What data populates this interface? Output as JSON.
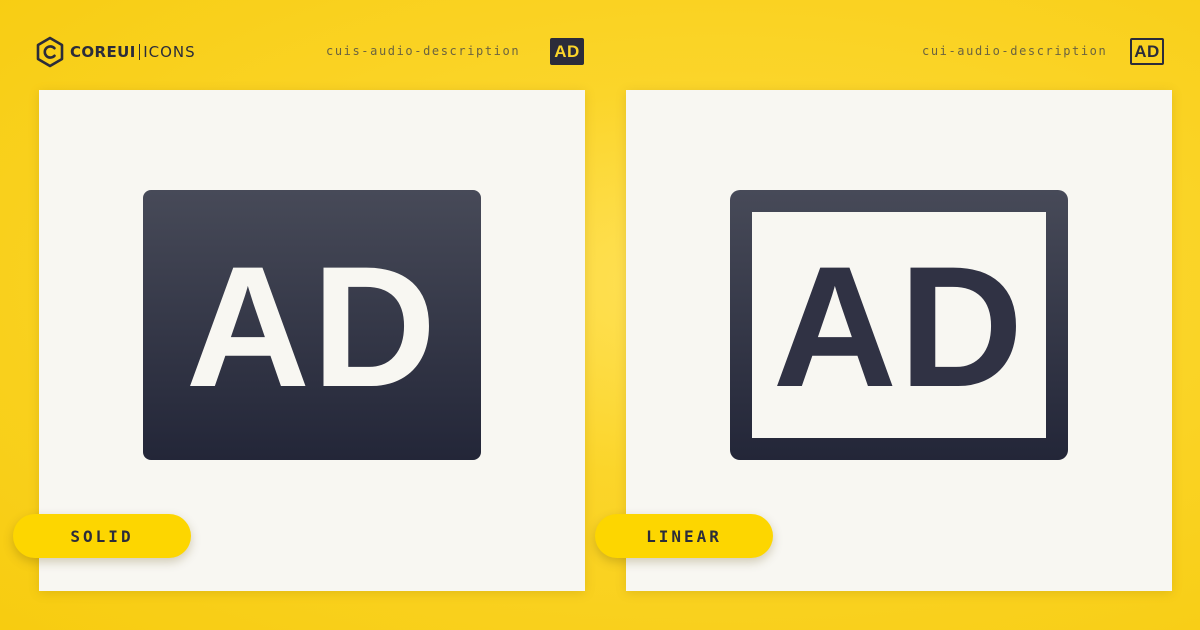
{
  "brand": {
    "logo_core": "COREUI",
    "logo_icons": "ICONS",
    "logo_icon": "coreui-hexagon-icon"
  },
  "variants": [
    {
      "style": "solid",
      "icon_name": "cuis-audio-description",
      "badge_text": "AD",
      "pill_label": "SOLID",
      "big_text": "AD"
    },
    {
      "style": "linear",
      "icon_name": "cui-audio-description",
      "badge_text": "AD",
      "pill_label": "LINEAR",
      "big_text": "AD"
    }
  ],
  "colors": {
    "background": "#f7cc10",
    "pill": "#fdd600",
    "icon_dark_top": "#474a58",
    "icon_dark_bottom": "#232638",
    "card": "#f8f7f2"
  }
}
